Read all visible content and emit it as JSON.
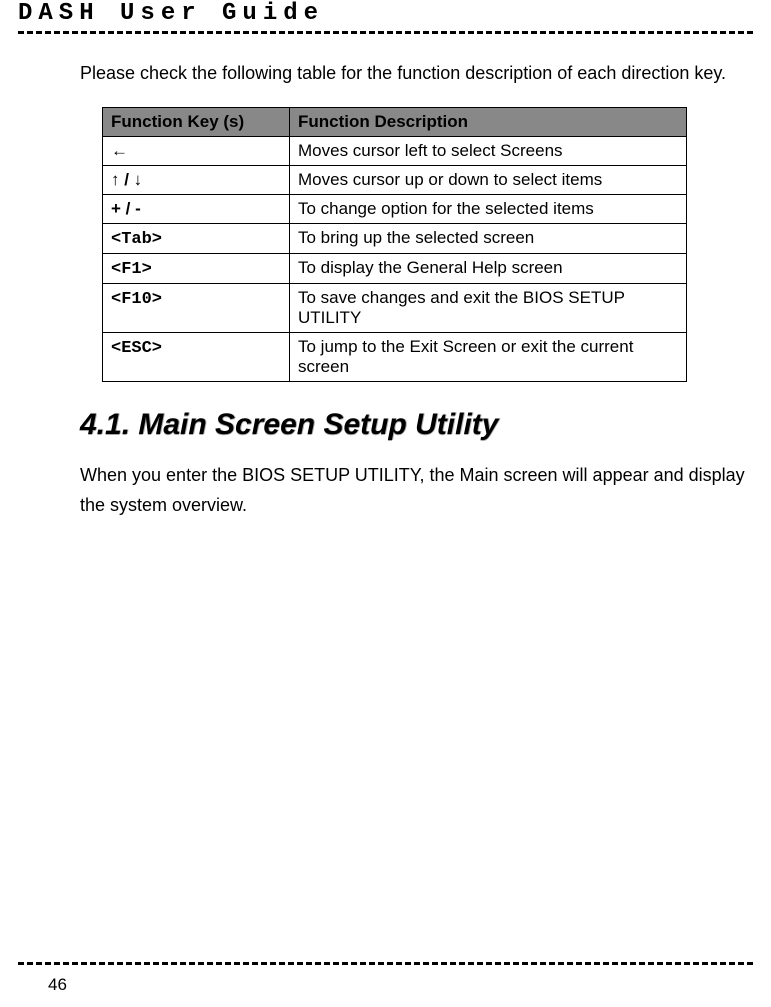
{
  "header": {
    "title": "DASH User Guide"
  },
  "intro": "Please check the following table for the function description of each direction key.",
  "table": {
    "headers": {
      "col1": "Function Key (s)",
      "col2": "Function Description"
    },
    "rows": [
      {
        "key": "←",
        "mono": false,
        "desc": "Moves cursor left to select Screens"
      },
      {
        "key": "↑ / ↓",
        "mono": false,
        "desc": "Moves cursor up or down to select items"
      },
      {
        "key": "+ / -",
        "mono": false,
        "desc": "To change option for the selected items"
      },
      {
        "key": "<Tab>",
        "mono": true,
        "desc": "To bring up the selected screen"
      },
      {
        "key": "<F1>",
        "mono": true,
        "desc": "To display the General Help screen"
      },
      {
        "key": "<F10>",
        "mono": true,
        "desc": "To save changes and exit the BIOS SETUP UTILITY"
      },
      {
        "key": "<ESC>",
        "mono": true,
        "desc": "To jump to the Exit Screen or exit the current screen"
      }
    ]
  },
  "section": {
    "heading": "4.1. Main Screen Setup Utility",
    "body": "When you enter the BIOS SETUP UTILITY, the Main screen will appear and display the system overview."
  },
  "footer": {
    "pageNumber": "46"
  }
}
